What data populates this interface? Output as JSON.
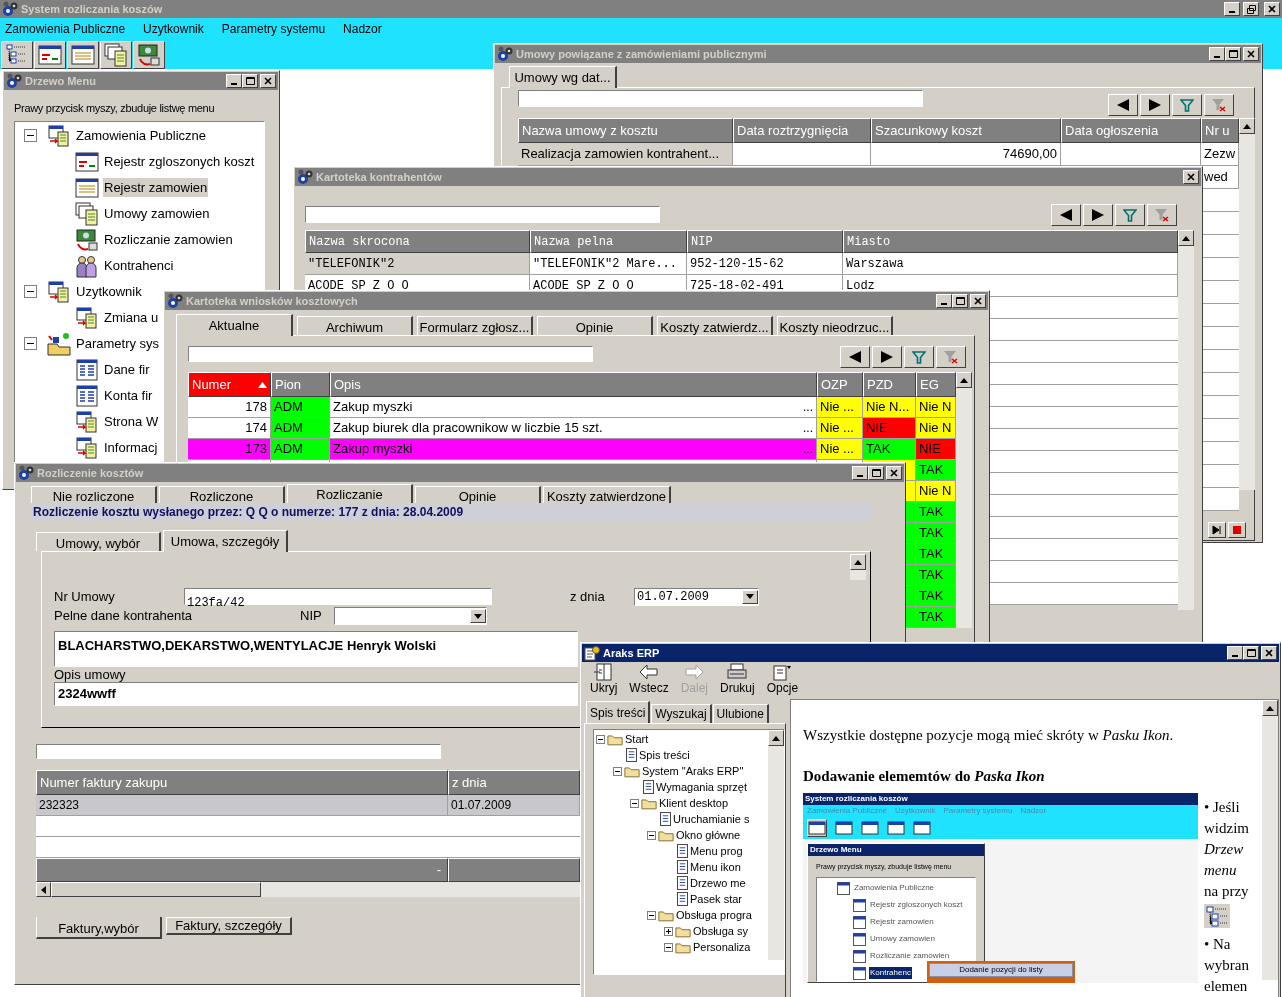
{
  "app": {
    "title": "System rozliczania koszów",
    "menu": [
      {
        "label": "Zamowienia Publiczne"
      },
      {
        "label": "Uzytkownik"
      },
      {
        "label": "Parametry systemu"
      },
      {
        "label": "Nadzor"
      }
    ],
    "toolbar": [
      {
        "kind": "tree"
      },
      {
        "kind": "register"
      },
      {
        "kind": "form"
      },
      {
        "kind": "contracts"
      },
      {
        "kind": "settlement"
      }
    ]
  },
  "menu_tree": {
    "title": "Drzewo Menu",
    "hint": "Prawy przycisk myszy, zbuduje listwę menu",
    "items": [
      {
        "label": "Zamowienia Publiczne",
        "kind": "module",
        "expanded": true,
        "selected": false,
        "children": [
          {
            "label": "Rejestr zgloszonych koszt",
            "kind": "register",
            "selected": false
          },
          {
            "label": "Rejestr zamowien",
            "kind": "form",
            "selected": true
          },
          {
            "label": "Umowy zamowien",
            "kind": "contracts",
            "selected": false
          },
          {
            "label": "Rozliczanie zamowien",
            "kind": "settlement",
            "selected": false
          },
          {
            "label": "Kontrahenci",
            "kind": "people",
            "selected": false
          }
        ]
      },
      {
        "label": "Uzytkownik",
        "kind": "module",
        "expanded": true,
        "selected": false,
        "children": [
          {
            "label": "Zmiana u",
            "kind": "module",
            "selected": false
          }
        ]
      },
      {
        "label": "Parametry sys",
        "kind": "settings",
        "expanded": true,
        "selected": false,
        "children": [
          {
            "label": "Dane fir",
            "kind": "table",
            "selected": false
          },
          {
            "label": "Konta fir",
            "kind": "table",
            "selected": false
          },
          {
            "label": "Strona W",
            "kind": "module",
            "selected": false
          },
          {
            "label": "Informacj",
            "kind": "module",
            "selected": false
          }
        ]
      }
    ]
  },
  "contracts_window": {
    "title": "Umowy powiązane z zamówieniami publicznymi",
    "tabs": [
      {
        "label": "Umowy wg dat...",
        "selected": true
      }
    ],
    "columns": [
      "Nazwa umowy z kosztu",
      "Data roztrzygnięcia",
      "Szacunkowy koszt",
      "Data ogłoszenia",
      "Nr u"
    ],
    "rows": [
      {
        "selected": true,
        "cells": [
          "Realizacja zamowien kontrahent...",
          null,
          "74690,00",
          null,
          "Zezw"
        ]
      },
      {
        "selected": false,
        "cells": [
          null,
          null,
          null,
          null,
          "wed"
        ]
      }
    ]
  },
  "contractors_window": {
    "title": "Kartoteka kontrahentów",
    "columns": [
      "Nazwa skrocona",
      "Nazwa pelna",
      "NIP",
      "Miasto"
    ],
    "rows": [
      {
        "selected": true,
        "cells": [
          "\"TELEFONIK\"2",
          "\"TELEFONIK\"2  Mare...",
          "952-120-15-62",
          "Warszawa"
        ]
      },
      {
        "selected": false,
        "cells": [
          "ACODE SP Z O O",
          "ACODE SP Z O O",
          "725-18-02-491",
          "Lodz"
        ]
      }
    ]
  },
  "requests_window": {
    "title": "Kartoteka wniosków kosztowych",
    "tabs": [
      {
        "label": "Aktualne",
        "selected": true
      },
      {
        "label": "Archiwum",
        "selected": false
      },
      {
        "label": "Formularz zgłosz...",
        "selected": false
      },
      {
        "label": "Opinie",
        "selected": false
      },
      {
        "label": "Koszty zatwierdz...",
        "selected": false
      },
      {
        "label": "Koszty nieodrzuc...",
        "selected": false
      }
    ],
    "columns": [
      "Numer",
      "Pion",
      "Opis",
      "OZP",
      "PZD",
      "EG"
    ],
    "sorted_column": {
      "color": "#ff0000"
    },
    "rows": [
      {
        "number": "178",
        "pion": {
          "text": "ADM",
          "color": "#00ff00"
        },
        "opis": "Zakup myszki",
        "more": "...",
        "ozp": {
          "text": "Nie ...",
          "color": "#ffff00"
        },
        "pzd": {
          "text": "Nie N...",
          "color": "#ffff00"
        },
        "eg": {
          "text": "Nie N",
          "color": "#ffff00"
        }
      },
      {
        "number": "174",
        "pion": {
          "text": "ADM",
          "color": "#00ff00"
        },
        "opis": "Zakup biurek dla pracownikow w liczbie 15 szt.",
        "more": "...",
        "ozp": {
          "text": "Nie ...",
          "color": "#ffff00"
        },
        "pzd": {
          "text": "NIE",
          "color": "#ff0000"
        },
        "eg": {
          "text": "Nie N",
          "color": "#ffff00"
        }
      },
      {
        "color": "#ff00ff",
        "number": "173",
        "pion": {
          "text": "ADM",
          "color": "#00ff00"
        },
        "opis": "Zakup myszki",
        "more": "...",
        "ozp": {
          "text": "Nie ...",
          "color": "#ffff00"
        },
        "pzd": {
          "text": "TAK",
          "color": "#00ff00"
        },
        "eg": {
          "text": "NIE",
          "color": "#ff0000"
        }
      },
      {
        "pzd": {
          "color": "#ffff00"
        },
        "eg": {
          "text": "TAK",
          "color": "#00ff00"
        }
      },
      {
        "pzd": {
          "color": "#ffff00"
        },
        "eg": {
          "text": "Nie N",
          "color": "#ffff00"
        }
      },
      {
        "pzd": {
          "color": "#00ff00"
        },
        "eg": {
          "text": "TAK",
          "color": "#00ff00"
        }
      },
      {
        "pzd": {
          "color": "#00ff00"
        },
        "eg": {
          "text": "TAK",
          "color": "#00ff00"
        }
      },
      {
        "pzd": {
          "color": "#00ff00"
        },
        "eg": {
          "text": "TAK",
          "color": "#00ff00"
        }
      },
      {
        "pzd": {
          "color": "#00ff00"
        },
        "eg": {
          "text": "TAK",
          "color": "#00ff00"
        }
      },
      {
        "pzd": {
          "color": "#00ff00"
        },
        "eg": {
          "text": "TAK",
          "color": "#00ff00"
        }
      },
      {
        "pzd": {
          "color": "#00ff00"
        },
        "eg": {
          "text": "TAK",
          "color": "#00ff00"
        }
      }
    ]
  },
  "settlement_window": {
    "title": "Rozliczenie kosztów",
    "tabs": [
      {
        "label": "Nie rozliczone",
        "selected": false
      },
      {
        "label": "Rozliczone",
        "selected": false
      },
      {
        "label": "Rozliczanie",
        "selected": true
      },
      {
        "label": "Opinie",
        "selected": false
      },
      {
        "label": "Koszty zatwierdzone",
        "selected": false
      }
    ],
    "heading": "Rozliczenie kosztu wysłanego przez: Q Q o numerze: 177 z dnia: 28.04.2009",
    "subtabs": [
      {
        "label": "Umowy, wybór",
        "selected": false
      },
      {
        "label": "Umowa, szczegóły",
        "selected": true
      }
    ],
    "contract_number": {
      "label": "Nr Umowy",
      "value": "123fa/42"
    },
    "date": {
      "label": "z dnia",
      "value": "01.07.2009"
    },
    "contractor": {
      "label": "Pelne dane kontrahenta",
      "value": "BLACHARSTWO,DEKARSTWO,WENTYLACJE Henryk Wolski"
    },
    "nip": {
      "label": "NIP"
    },
    "description": {
      "label": "Opis umowy",
      "value": "2324wwff"
    },
    "invoices": {
      "columns": [
        "Numer faktury zakupu",
        "z dnia"
      ],
      "rows": [
        {
          "selected": true,
          "cells": [
            "232323",
            "01.07.2009"
          ]
        }
      ],
      "footer": "-"
    },
    "bottom_tabs": [
      {
        "label": "Faktury,wybór",
        "selected": true
      },
      {
        "label": "Faktury, szczegóły",
        "selected": false
      }
    ]
  },
  "help_window": {
    "title": "Araks ERP",
    "toolbar": [
      {
        "label": "Ukryj",
        "kind": "hide",
        "disabled": false
      },
      {
        "label": "Wstecz",
        "kind": "back",
        "disabled": false
      },
      {
        "label": "Dalej",
        "kind": "forward",
        "disabled": true
      },
      {
        "label": "Drukuj",
        "kind": "print",
        "disabled": false
      },
      {
        "label": "Opcje",
        "kind": "options",
        "disabled": false
      }
    ],
    "tabs": [
      {
        "label": "Spis treści",
        "selected": true
      },
      {
        "label": "Wyszukaj",
        "selected": false
      },
      {
        "label": "Ulubione",
        "selected": false
      }
    ],
    "tree": [
      {
        "label": "Start",
        "kind": "folder",
        "expanded": true,
        "children": [
          {
            "label": "Spis treści",
            "kind": "page"
          },
          {
            "label": "System \"Araks ERP\"",
            "kind": "folder",
            "expanded": true,
            "children": [
              {
                "label": "Wymagania sprzęt",
                "kind": "page"
              },
              {
                "label": "Klient desktop",
                "kind": "folder",
                "expanded": true,
                "children": [
                  {
                    "label": "Uruchamianie s",
                    "kind": "page"
                  },
                  {
                    "label": "Okno główne",
                    "kind": "folder",
                    "expanded": true,
                    "children": [
                      {
                        "label": "Menu prog",
                        "kind": "page"
                      },
                      {
                        "label": "Menu ikon",
                        "kind": "page"
                      },
                      {
                        "label": "Drzewo me",
                        "kind": "page"
                      },
                      {
                        "label": "Pasek star",
                        "kind": "page"
                      }
                    ]
                  },
                  {
                    "label": "Obsługa progra",
                    "kind": "folder",
                    "expanded": true,
                    "children": [
                      {
                        "label": "Obsługa sy",
                        "kind": "folder",
                        "expanded": false
                      },
                      {
                        "label": "Personaliza",
                        "kind": "folder",
                        "expanded": true
                      }
                    ]
                  }
                ]
              }
            ]
          }
        ]
      }
    ],
    "paragraph": "Wszystkie dostępne pozycje mogą mieć skróty w *Pasku Ikon*.",
    "heading": "Dodawanie elememtów do *Paska Ikon*",
    "screenshot": {
      "title": "System rozliczania koszów",
      "menu": [
        "Zamowienia Publiczne",
        "Uzytkownik",
        "Parametry systemu",
        "Nadzor"
      ],
      "tree_title": "Drzewo Menu",
      "hint": "Prawy przycisk myszy, zbuduje listwę menu",
      "items": [
        {
          "label": "Zamowienia Publiczne",
          "selected": false
        },
        {
          "label": "Rejestr zgloszonych koszt",
          "selected": false
        },
        {
          "label": "Rejestr zamowien",
          "selected": false
        },
        {
          "label": "Umowy zamowien",
          "selected": false
        },
        {
          "label": "Rozliczanie zamowien",
          "selected": false
        },
        {
          "label": "Kontrahenc",
          "selected": true
        }
      ],
      "popup": "Dodanie pozycji do listy"
    },
    "side_text": [
      {
        "kind": "bullet",
        "bullet": "•",
        "text": "Jeśli"
      },
      {
        "kind": "line",
        "text": "widzim"
      },
      {
        "kind": "line",
        "text": "*Drzew*"
      },
      {
        "kind": "line",
        "text": "*menu*"
      },
      {
        "kind": "line",
        "text": "na przy"
      },
      {
        "kind": "icon"
      },
      {
        "kind": "bullet",
        "bullet": "•",
        "text": "Na"
      },
      {
        "kind": "line",
        "text": "wybran"
      },
      {
        "kind": "line",
        "text": "elemen"
      }
    ]
  }
}
